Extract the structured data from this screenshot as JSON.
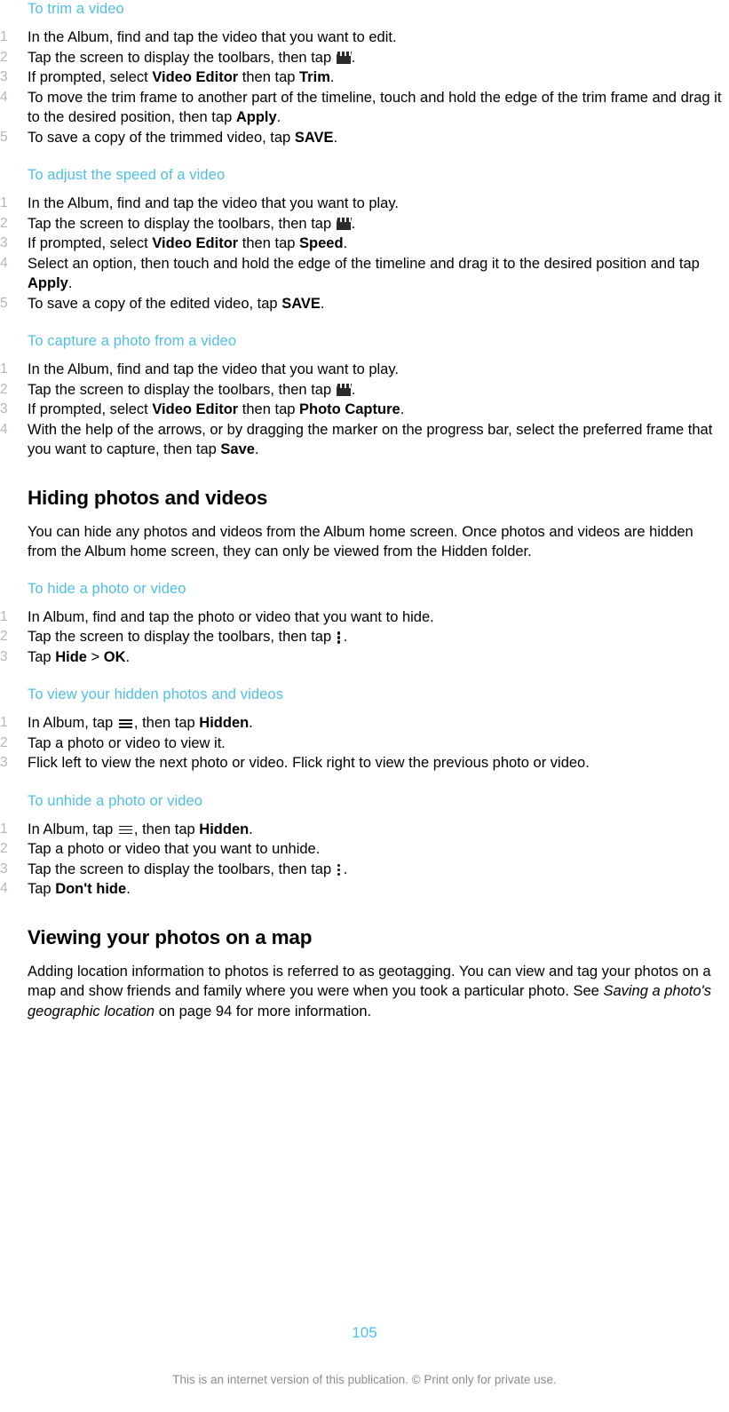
{
  "document": {
    "page_number": "105",
    "footer_note": "This is an internet version of this publication. © Print only for private use.",
    "accent_color": "#4fbfe6",
    "number_color": "#b5b5b5",
    "footer_color": "#8c8c8c"
  },
  "procedures": {
    "trim_video": {
      "heading": "To trim a video",
      "steps": [
        {
          "num": "1",
          "parts": [
            {
              "t": "In the Album, find and tap the video that you want to edit."
            }
          ]
        },
        {
          "num": "2",
          "parts": [
            {
              "t": "Tap the screen to display the toolbars, then tap "
            },
            {
              "icon": "video-editor-clapperboard-icon"
            },
            {
              "t": "."
            }
          ]
        },
        {
          "num": "3",
          "parts": [
            {
              "t": "If prompted, select "
            },
            {
              "t": "Video Editor",
              "b": true
            },
            {
              "t": " then tap "
            },
            {
              "t": "Trim",
              "b": true
            },
            {
              "t": "."
            }
          ]
        },
        {
          "num": "4",
          "parts": [
            {
              "t": "To move the trim frame to another part of the timeline, touch and hold the edge of the trim frame and drag it to the desired position, then tap "
            },
            {
              "t": "Apply",
              "b": true
            },
            {
              "t": "."
            }
          ]
        },
        {
          "num": "5",
          "parts": [
            {
              "t": "To save a copy of the trimmed video, tap "
            },
            {
              "t": "SAVE",
              "b": true
            },
            {
              "t": "."
            }
          ]
        }
      ]
    },
    "adjust_speed": {
      "heading": "To adjust the speed of a video",
      "steps": [
        {
          "num": "1",
          "parts": [
            {
              "t": "In the Album, find and tap the video that you want to play."
            }
          ]
        },
        {
          "num": "2",
          "parts": [
            {
              "t": "Tap the screen to display the toolbars, then tap "
            },
            {
              "icon": "video-editor-clapperboard-icon"
            },
            {
              "t": "."
            }
          ]
        },
        {
          "num": "3",
          "parts": [
            {
              "t": "If prompted, select "
            },
            {
              "t": "Video Editor",
              "b": true
            },
            {
              "t": " then tap "
            },
            {
              "t": "Speed",
              "b": true
            },
            {
              "t": "."
            }
          ]
        },
        {
          "num": "4",
          "parts": [
            {
              "t": "Select an option, then touch and hold the edge of the timeline and drag it to the desired position and tap "
            },
            {
              "t": "Apply",
              "b": true
            },
            {
              "t": "."
            }
          ]
        },
        {
          "num": "5",
          "parts": [
            {
              "t": "To save a copy of the edited video, tap "
            },
            {
              "t": "SAVE",
              "b": true
            },
            {
              "t": "."
            }
          ]
        }
      ]
    },
    "capture_photo": {
      "heading": "To capture a photo from a video",
      "steps": [
        {
          "num": "1",
          "parts": [
            {
              "t": "In the Album, find and tap the video that you want to play."
            }
          ]
        },
        {
          "num": "2",
          "parts": [
            {
              "t": "Tap the screen to display the toolbars, then tap "
            },
            {
              "icon": "video-editor-clapperboard-icon"
            },
            {
              "t": "."
            }
          ]
        },
        {
          "num": "3",
          "parts": [
            {
              "t": "If prompted, select "
            },
            {
              "t": "Video Editor",
              "b": true
            },
            {
              "t": " then tap "
            },
            {
              "t": "Photo Capture",
              "b": true
            },
            {
              "t": "."
            }
          ]
        },
        {
          "num": "4",
          "parts": [
            {
              "t": "With the help of the arrows, or by dragging the marker on the progress bar, select the preferred frame that you want to capture, then tap "
            },
            {
              "t": "Save",
              "b": true
            },
            {
              "t": "."
            }
          ]
        }
      ]
    },
    "hide_photo": {
      "heading": "To hide a photo or video",
      "steps": [
        {
          "num": "1",
          "parts": [
            {
              "t": "In Album, find and tap the photo or video that you want to hide."
            }
          ]
        },
        {
          "num": "2",
          "parts": [
            {
              "t": "Tap the screen to display the toolbars, then tap "
            },
            {
              "icon": "overflow-menu-kebab-icon"
            },
            {
              "t": "."
            }
          ]
        },
        {
          "num": "3",
          "parts": [
            {
              "t": "Tap "
            },
            {
              "t": "Hide",
              "b": true
            },
            {
              "t": " > "
            },
            {
              "t": "OK",
              "b": true
            },
            {
              "t": "."
            }
          ]
        }
      ]
    },
    "view_hidden": {
      "heading": "To view your hidden photos and videos",
      "steps": [
        {
          "num": "1",
          "parts": [
            {
              "t": "In Album, tap "
            },
            {
              "icon": "hamburger-menu-icon"
            },
            {
              "t": ", then tap "
            },
            {
              "t": "Hidden",
              "b": true
            },
            {
              "t": "."
            }
          ]
        },
        {
          "num": "2",
          "parts": [
            {
              "t": "Tap a photo or video to view it."
            }
          ]
        },
        {
          "num": "3",
          "parts": [
            {
              "t": "Flick left to view the next photo or video. Flick right to view the previous photo or video."
            }
          ]
        }
      ]
    },
    "unhide_photo": {
      "heading": "To unhide a photo or video",
      "steps": [
        {
          "num": "1",
          "parts": [
            {
              "t": "In Album, tap "
            },
            {
              "icon": "hamburger-menu-icon"
            },
            {
              "t": ", then tap "
            },
            {
              "t": "Hidden",
              "b": true
            },
            {
              "t": "."
            }
          ]
        },
        {
          "num": "2",
          "parts": [
            {
              "t": "Tap a photo or video that you want to unhide."
            }
          ]
        },
        {
          "num": "3",
          "parts": [
            {
              "t": "Tap the screen to display the toolbars, then tap "
            },
            {
              "icon": "overflow-menu-kebab-icon"
            },
            {
              "t": "."
            }
          ]
        },
        {
          "num": "4",
          "parts": [
            {
              "t": "Tap "
            },
            {
              "t": "Don't hide",
              "b": true
            },
            {
              "t": "."
            }
          ]
        }
      ]
    }
  },
  "sections": {
    "hiding": {
      "heading": "Hiding photos and videos",
      "paragraph": [
        {
          "t": "You can hide any photos and videos from the Album home screen. Once photos and videos are hidden from the Album home screen, they can only be viewed from the Hidden folder."
        }
      ]
    },
    "viewing_map": {
      "heading": "Viewing your photos on a map",
      "paragraph": [
        {
          "t": "Adding location information to photos is referred to as geotagging. You can view and tag your photos on a map and show friends and family where you were when you took a particular photo. See "
        },
        {
          "t": "Saving a photo's geographic location",
          "i": true
        },
        {
          "t": " on page 94 for more information."
        }
      ]
    }
  }
}
